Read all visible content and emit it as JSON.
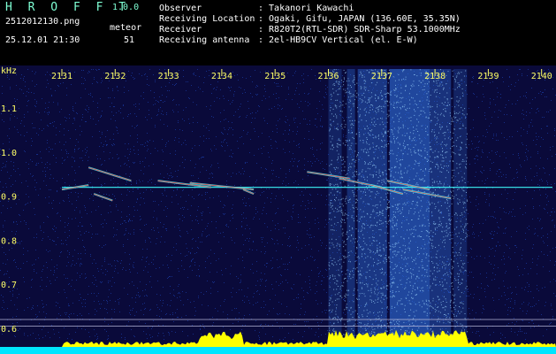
{
  "header": {
    "app_title": "H R O F F T",
    "app_version": "1.0.0",
    "file_name": "2512012130.png",
    "meteor_label": "meteor",
    "date_time": "25.12.01 21:30",
    "meteor_count": "51",
    "info": [
      {
        "label": "Observer",
        "value": ": Takanori Kawachi"
      },
      {
        "label": "Receiving Location",
        "value": ": Ogaki, Gifu, JAPAN (136.60E, 35.35N)"
      },
      {
        "label": "Receiver",
        "value": ": R820T2(RTL-SDR) SDR-Sharp 53.1000MHz"
      },
      {
        "label": "Receiving antenna",
        "value": ": 2el-HB9CV Vertical (el. E-W)"
      }
    ]
  },
  "axes": {
    "y_unit": "kHz",
    "y_ticks": [
      "1.1",
      "1.0",
      "0.9",
      "0.8",
      "0.7",
      "0.6"
    ],
    "y_tick_values": [
      1.1,
      1.0,
      0.9,
      0.8,
      0.7,
      0.6
    ],
    "x_ticks": [
      "2131",
      "2132",
      "2133",
      "2134",
      "2135",
      "2136",
      "2137",
      "2138",
      "2139",
      "2140"
    ]
  },
  "colors": {
    "background": "#0a0a3a",
    "noise": "#1a3aa0",
    "carrier": "#40ffff",
    "meteor": "#ff4040",
    "tick_label": "#ffff66",
    "activity": "#ffff00",
    "activity_base": "#00e5ff"
  },
  "meteors": [
    {
      "x1": 2131.0,
      "y1": 0.915,
      "x2": 2131.5,
      "y2": 0.925
    },
    {
      "x1": 2131.5,
      "y1": 0.965,
      "x2": 2132.3,
      "y2": 0.935
    },
    {
      "x1": 2131.6,
      "y1": 0.905,
      "x2": 2131.95,
      "y2": 0.89
    },
    {
      "x1": 2132.8,
      "y1": 0.935,
      "x2": 2133.8,
      "y2": 0.92
    },
    {
      "x1": 2133.4,
      "y1": 0.93,
      "x2": 2134.6,
      "y2": 0.915
    },
    {
      "x1": 2134.4,
      "y1": 0.915,
      "x2": 2134.6,
      "y2": 0.905
    },
    {
      "x1": 2135.6,
      "y1": 0.955,
      "x2": 2136.4,
      "y2": 0.94
    },
    {
      "x1": 2136.2,
      "y1": 0.94,
      "x2": 2137.0,
      "y2": 0.92
    },
    {
      "x1": 2136.8,
      "y1": 0.925,
      "x2": 2137.4,
      "y2": 0.905
    },
    {
      "x1": 2137.1,
      "y1": 0.935,
      "x2": 2137.9,
      "y2": 0.915
    },
    {
      "x1": 2137.4,
      "y1": 0.915,
      "x2": 2138.3,
      "y2": 0.895
    }
  ]
}
